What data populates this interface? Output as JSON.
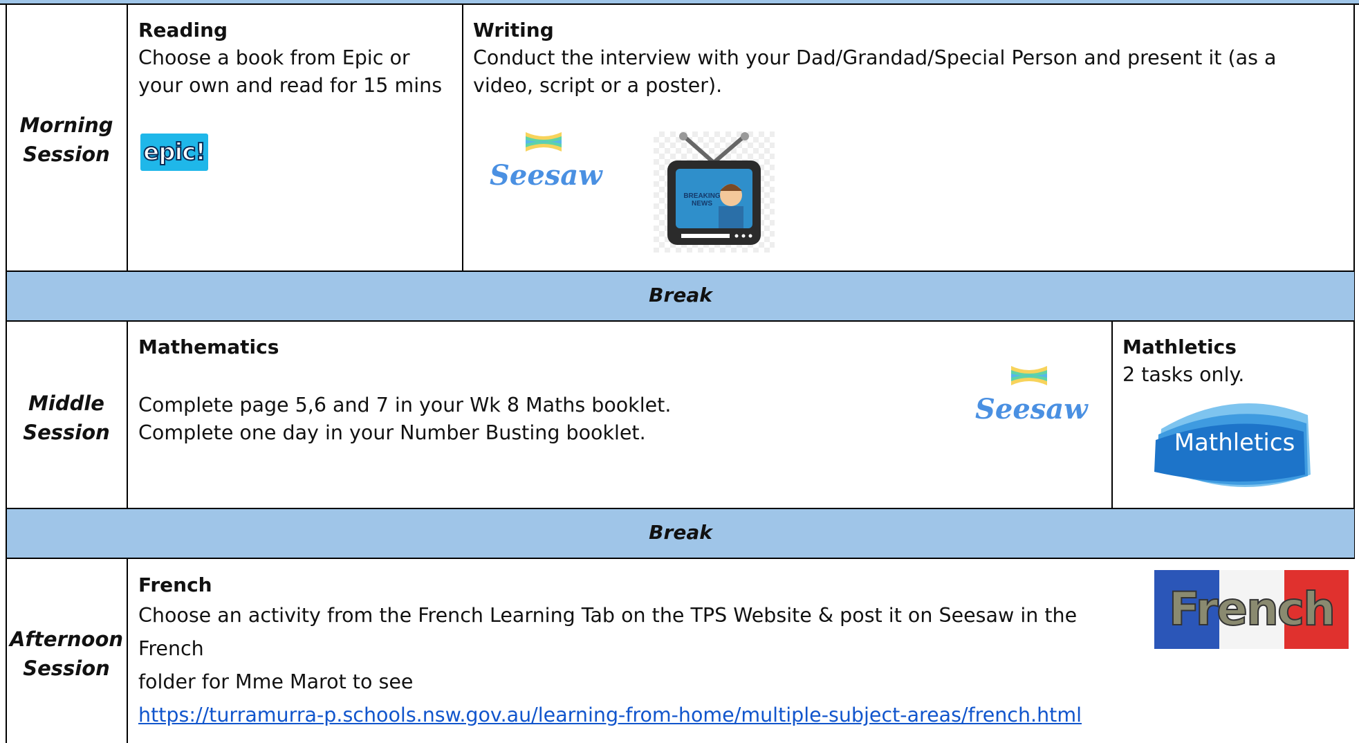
{
  "morning": {
    "session_line1": "Morning",
    "session_line2": "Session",
    "reading": {
      "title": "Reading",
      "line1": "Choose a book from Epic or",
      "line2": "your own and read for 15 mins",
      "logo_text": "epic!"
    },
    "writing": {
      "title": "Writing",
      "line1": "Conduct the interview with your Dad/Grandad/Special Person and present it (as a",
      "line2": "video, script or a poster).",
      "seesaw_text": "Seesaw",
      "tv_text_line1": "BREAKING",
      "tv_text_line2": "NEWS"
    }
  },
  "break1": {
    "label": "Break"
  },
  "middle": {
    "session_line1": "Middle",
    "session_line2": "Session",
    "maths": {
      "title": "Mathematics",
      "line1": "Complete page 5,6 and 7 in your Wk 8 Maths booklet.",
      "line2": "Complete one day in your Number Busting booklet.",
      "seesaw_text": "Seesaw"
    },
    "mathletics": {
      "title": "Mathletics",
      "line1": "2 tasks only.",
      "logo_text": "Mathletics"
    }
  },
  "break2": {
    "label": "Break"
  },
  "afternoon": {
    "session_line1": "Afternoon",
    "session_line2": "Session",
    "french": {
      "title": "French",
      "line1": "Choose an activity from the French Learning Tab on the TPS Website & post it on Seesaw in the French",
      "line2": "folder for Mme Marot to see",
      "link": "https://turramurra-p.schools.nsw.gov.au/learning-from-home/multiple-subject-areas/french.html",
      "logo_text": "French"
    }
  },
  "colors": {
    "band": "#9fc5e8",
    "link": "#1155cc",
    "epic": "#1fb7e9",
    "seesaw": "#4a90e2",
    "mathletics": "#1d74c9"
  }
}
